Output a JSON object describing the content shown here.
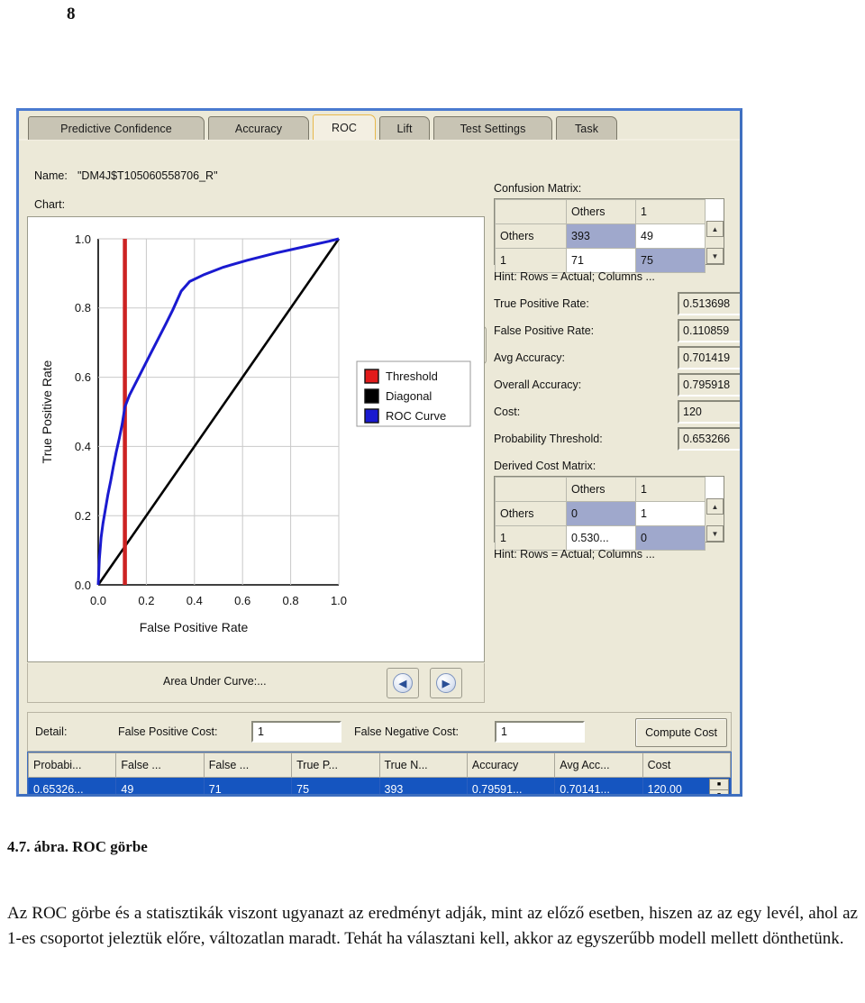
{
  "page": {
    "number": "8"
  },
  "window": {
    "tabs": [
      {
        "label": "Predictive Confidence",
        "selected": false
      },
      {
        "label": "Accuracy",
        "selected": false
      },
      {
        "label": "ROC",
        "selected": true
      },
      {
        "label": "Lift",
        "selected": false
      },
      {
        "label": "Test Settings",
        "selected": false
      },
      {
        "label": "Task",
        "selected": false
      }
    ],
    "name_label": "Name:",
    "name_value": "\"DM4J$T105060558706_R\"",
    "chart_label": "Chart:",
    "export_icon": "export-to-spreadsheet-icon",
    "area_under_curve_label": "Area Under Curve:...",
    "nav_prev_icon": "chevron-left-icon",
    "nav_next_icon": "chevron-right-icon"
  },
  "confusion_matrix": {
    "title": "Confusion Matrix:",
    "columns": [
      "",
      "Others",
      "1"
    ],
    "rows": [
      {
        "header": "Others",
        "cells": [
          "393",
          "49"
        ]
      },
      {
        "header": "1",
        "cells": [
          "71",
          "75"
        ]
      }
    ],
    "hint": "Hint: Rows = Actual; Columns ...",
    "scroll_up_icon": "triangle-up-icon",
    "scroll_down_icon": "triangle-down-icon"
  },
  "statistics": [
    {
      "label": "True Positive Rate:",
      "value": "0.513698"
    },
    {
      "label": "False Positive Rate:",
      "value": "0.110859"
    },
    {
      "label": "Avg Accuracy:",
      "value": "0.701419"
    },
    {
      "label": "Overall Accuracy:",
      "value": "0.795918"
    },
    {
      "label": "Cost:",
      "value": "120"
    },
    {
      "label": "Probability Threshold:",
      "value": "0.653266"
    }
  ],
  "derived_cost_matrix": {
    "title": "Derived Cost Matrix:",
    "columns": [
      "",
      "Others",
      "1"
    ],
    "rows": [
      {
        "header": "Others",
        "cells": [
          "0",
          "1"
        ]
      },
      {
        "header": "1",
        "cells": [
          "0.530...",
          "0"
        ]
      }
    ],
    "hint": "Hint: Rows = Actual; Columns ...",
    "scroll_up_icon": "triangle-up-icon",
    "scroll_down_icon": "triangle-down-icon"
  },
  "detail": {
    "label": "Detail:",
    "false_positive_cost_label": "False Positive Cost:",
    "false_positive_cost_value": "1",
    "false_negative_cost_label": "False Negative Cost:",
    "false_negative_cost_value": "1",
    "compute_cost_label": "Compute Cost"
  },
  "results_grid": {
    "columns": [
      "Probabi...",
      "False ...",
      "False ...",
      "True P...",
      "True N...",
      "Accuracy",
      "Avg Acc...",
      "Cost"
    ],
    "rows": [
      [
        "0.65326...",
        "49",
        "71",
        "75",
        "393",
        "0.79591...",
        "0.70141...",
        "120.00"
      ]
    ],
    "spinner_up_icon": "spinner-up-icon",
    "spinner_down_icon": "spinner-down-icon"
  },
  "chart_data": {
    "type": "line",
    "title": "",
    "xlabel": "False Positive Rate",
    "ylabel": "True Positive Rate",
    "xlim": [
      0,
      1
    ],
    "ylim": [
      0,
      1
    ],
    "xticks": [
      "0.0",
      "0.2",
      "0.4",
      "0.6",
      "0.8",
      "1.0"
    ],
    "yticks": [
      "0.0",
      "0.2",
      "0.4",
      "0.6",
      "0.8",
      "1.0"
    ],
    "grid": true,
    "legend_position": "right",
    "colors": {
      "threshold": "#cc2222",
      "diagonal": "#000000",
      "roc": "#1a1ad0"
    },
    "series": [
      {
        "name": "ROC Curve",
        "color": "#1a1ad0",
        "points": [
          [
            0.0,
            0.0
          ],
          [
            0.005,
            0.075
          ],
          [
            0.012,
            0.137
          ],
          [
            0.02,
            0.178
          ],
          [
            0.03,
            0.219
          ],
          [
            0.04,
            0.26
          ],
          [
            0.052,
            0.301
          ],
          [
            0.063,
            0.342
          ],
          [
            0.075,
            0.384
          ],
          [
            0.088,
            0.425
          ],
          [
            0.1,
            0.466
          ],
          [
            0.111,
            0.514
          ],
          [
            0.13,
            0.548
          ],
          [
            0.16,
            0.589
          ],
          [
            0.19,
            0.63
          ],
          [
            0.22,
            0.671
          ],
          [
            0.25,
            0.712
          ],
          [
            0.28,
            0.753
          ],
          [
            0.31,
            0.795
          ],
          [
            0.345,
            0.849
          ],
          [
            0.38,
            0.877
          ],
          [
            0.44,
            0.897
          ],
          [
            0.52,
            0.918
          ],
          [
            0.62,
            0.938
          ],
          [
            0.74,
            0.959
          ],
          [
            0.87,
            0.979
          ],
          [
            0.96,
            0.993
          ],
          [
            1.0,
            1.0
          ]
        ]
      },
      {
        "name": "Diagonal",
        "color": "#000000",
        "points": [
          [
            0.0,
            0.0
          ],
          [
            1.0,
            1.0
          ]
        ]
      },
      {
        "name": "Threshold",
        "color": "#cc2222",
        "vertical_line_x": 0.111
      }
    ],
    "legend": [
      {
        "label": "Threshold",
        "color": "#cc2222"
      },
      {
        "label": "Diagonal",
        "color": "#000000"
      },
      {
        "label": "ROC Curve",
        "color": "#1a1ad0"
      }
    ]
  },
  "caption": {
    "figure": "4.7. ábra. ROC görbe",
    "body": "Az ROC görbe és a statisztikák viszont ugyanazt az eredményt adják, mint az előző esetben, hiszen az az egy levél, ahol az 1-es csoportot jeleztük előre, változatlan maradt. Tehát ha választani kell, akkor az egyszerűbb modell mellett dönthetünk."
  }
}
